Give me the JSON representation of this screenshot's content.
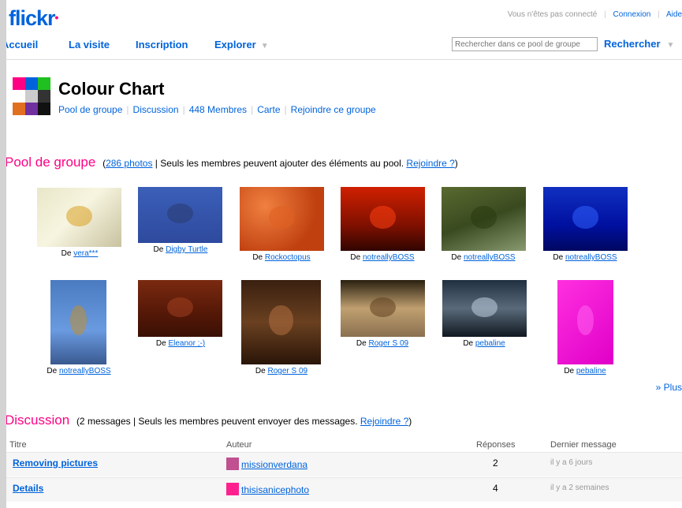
{
  "header": {
    "logo_text": "flickr",
    "logo_dot": "•",
    "not_connected": "Vous n'êtes pas connecté",
    "login": "Connexion",
    "help": "Aide"
  },
  "nav": {
    "home": "Accueil",
    "tour": "La visite",
    "signup": "Inscription",
    "explore": "Explorer",
    "chevron": "▼",
    "search_placeholder": "Rechercher dans ce pool de groupe",
    "search_button": "Rechercher"
  },
  "group": {
    "title": "Colour Chart",
    "links": [
      "Pool de groupe",
      "Discussion",
      "448 Membres",
      "Carte",
      "Rejoindre ce groupe"
    ]
  },
  "pool": {
    "title": "Pool de groupe",
    "open_paren": "(",
    "photos_link": "286 photos",
    "meta": " | Seuls les membres peuvent ajouter des éléments au pool. ",
    "join_link": "Rejoindre ?",
    "close_paren": ")",
    "by_prefix": "De",
    "more": "» Plus",
    "photos": [
      {
        "author": "vera***",
        "bg": "linear-gradient(135deg,#e8e7c8 0%,#f7f5e0 45%,#c8c2a0 100%)",
        "accent": "#d8a020"
      },
      {
        "author": "Digby Turtle",
        "bg": "linear-gradient(180deg,#3b5fb8 0%,#2e4a9e 100%)",
        "accent": "#2a3a70"
      },
      {
        "author": "Rockoctopus",
        "bg": "radial-gradient(circle at 30% 30%,#f08040 0%,#c04010 70%)",
        "accent": "#e06020"
      },
      {
        "author": "notreallyBOSS",
        "bg": "linear-gradient(180deg,#d02000 0%,#801000 60%,#300500 100%)",
        "accent": "#ff4010"
      },
      {
        "author": "notreallyBOSS",
        "bg": "linear-gradient(160deg,#5a6a30 0%,#3a4a20 50%,#8a9a70 100%)",
        "accent": "#2a3a10"
      },
      {
        "author": "notreallyBOSS",
        "bg": "linear-gradient(180deg,#1030c0 0%,#0010a0 60%,#000860 100%)",
        "accent": "#3060ff"
      },
      {
        "author": "notreallyBOSS",
        "bg": "linear-gradient(180deg,#4a7ac0 0%,#6a9ae0 60%,#3a5a90 100%)",
        "accent": "#c09030"
      },
      {
        "author": "Eleanor ;-)",
        "bg": "linear-gradient(180deg,#7a2a10 0%,#5a1a08 50%,#3a1005 100%)",
        "accent": "#a04020"
      },
      {
        "author": "Roger S 09",
        "bg": "linear-gradient(180deg,#3a2010 0%,#6a4020 50%,#2a1508 100%)",
        "accent": "#b07040"
      },
      {
        "author": "Roger S 09",
        "bg": "linear-gradient(180deg,#2a2010 0%,#c0a070 50%,#8a7050 100%)",
        "accent": "#604020"
      },
      {
        "author": "pebaline",
        "bg": "linear-gradient(180deg,#203040 0%,#5a6a7a 50%,#101820 100%)",
        "accent": "#c0d0e0"
      },
      {
        "author": "pebaline",
        "bg": "linear-gradient(135deg,#ff30e0 0%,#e000c8 100%)",
        "accent": "#ff60f0"
      }
    ]
  },
  "discussion": {
    "title": "Discussion",
    "meta": "(2 messages | Seuls les membres peuvent envoyer des messages. ",
    "join_link": "Rejoindre ?",
    "close_paren": ")",
    "col_title": "Titre",
    "col_author": "Auteur",
    "col_replies": "Réponses",
    "col_last": "Dernier message",
    "rows": [
      {
        "title": "Removing pictures",
        "author": "missionverdana",
        "replies": "2",
        "last": "il y a 6 jours",
        "avatar_color": "#c05090"
      },
      {
        "title": "Details",
        "author": "thisisanicephoto",
        "replies": "4",
        "last": "il y a 2 semaines",
        "avatar_color": "#ff2090"
      }
    ]
  },
  "colors": {
    "link": "#0063dc",
    "accent": "#ff0084",
    "buddy": [
      "#ff0084",
      "#0063dc",
      "#20c020",
      "#ffffff",
      "#cccccc",
      "#333333",
      "#e07020",
      "#7030a0",
      "#111111"
    ]
  }
}
